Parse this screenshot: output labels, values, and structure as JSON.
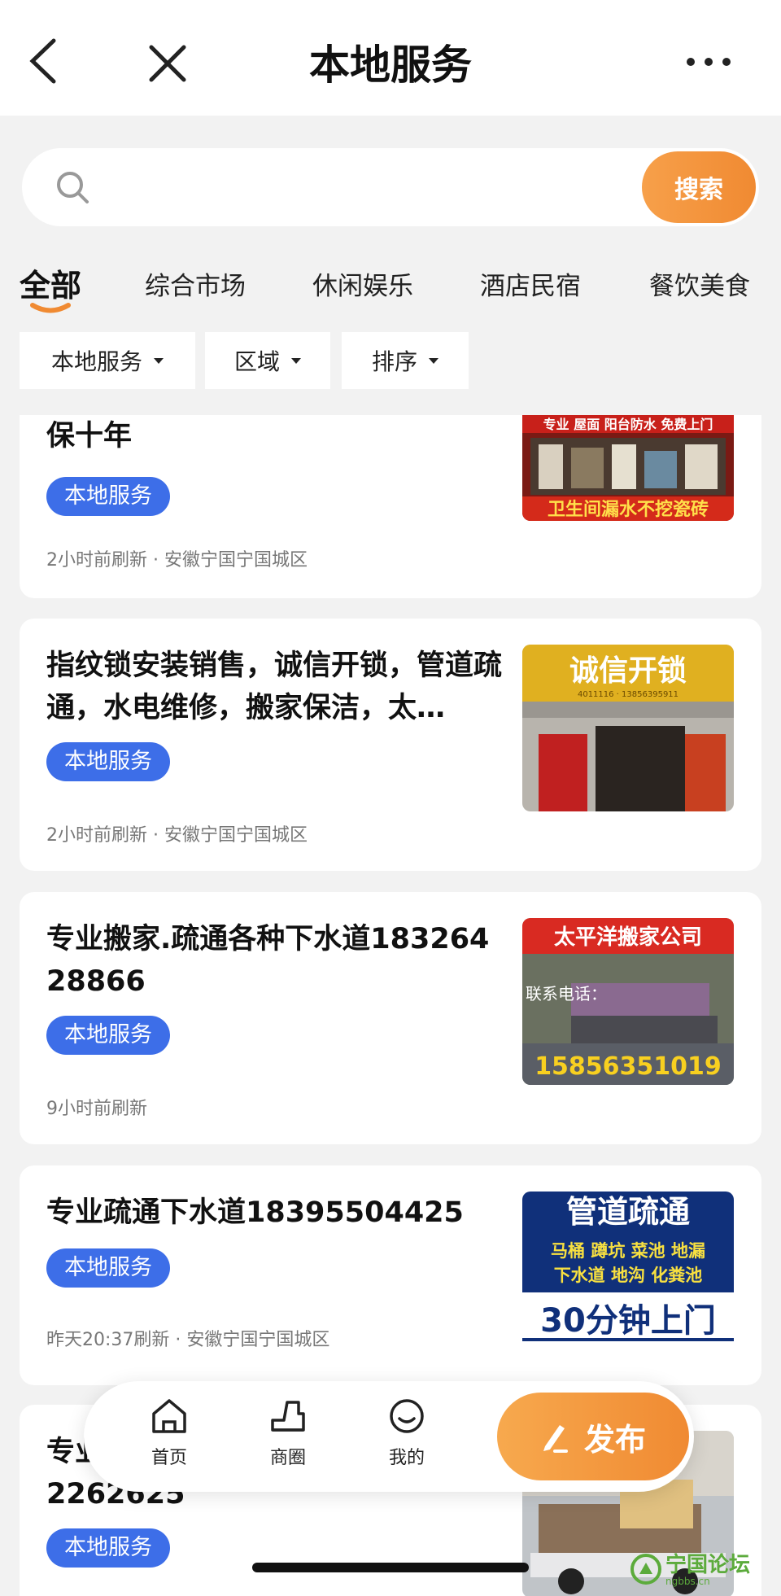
{
  "header": {
    "title": "本地服务"
  },
  "search": {
    "placeholder": "",
    "button_label": "搜索"
  },
  "categories": [
    "全部",
    "综合市场",
    "休闲娱乐",
    "酒店民宿",
    "餐饮美食"
  ],
  "filters": [
    "本地服务",
    "区域",
    "排序"
  ],
  "listings": [
    {
      "title": "保十年",
      "tag": "本地服务",
      "meta": "2小时前刷新 · 安徽宁国宁国城区",
      "image_text": [
        "专业 屋面 阳台防水 免费上门",
        "卫生间漏水不挖瓷砖"
      ]
    },
    {
      "title": "指纹锁安装销售，诚信开锁，管道疏通，水电维修，搬家保洁，太…",
      "tag": "本地服务",
      "meta": "2小时前刷新 · 安徽宁国宁国城区",
      "image_text": [
        "诚信开锁",
        "4011116 · 13856395911"
      ]
    },
    {
      "title": "专业搬家.疏通各种下水道18326428866",
      "tag": "本地服务",
      "meta": "9小时前刷新",
      "image_text": [
        "太平洋搬家公司",
        "联系电话：",
        "15856351019"
      ]
    },
    {
      "title": "专业疏通下水道18395504425",
      "tag": "本地服务",
      "meta": "昨天20:37刷新 · 安徽宁国宁国城区",
      "image_text": [
        "管道疏通",
        "马桶 蹲坑 菜池 地漏",
        "下水道 地沟 化粪池",
        "30分钟上门"
      ]
    },
    {
      "title": "专业",
      "title_line2": "2262625",
      "tag": "本地服务",
      "meta": "",
      "image_text": []
    }
  ],
  "bottom_nav": {
    "items": [
      {
        "label": "首页",
        "icon": "home-icon"
      },
      {
        "label": "商圈",
        "icon": "business-circle-icon"
      },
      {
        "label": "我的",
        "icon": "profile-icon"
      }
    ],
    "publish_label": "发布"
  },
  "watermark": {
    "text": "宁国论坛",
    "sub": "ngbbs.cn"
  },
  "colors": {
    "accent": "#f08a32",
    "tag": "#3d6ee8",
    "background": "#f2f2f2"
  }
}
